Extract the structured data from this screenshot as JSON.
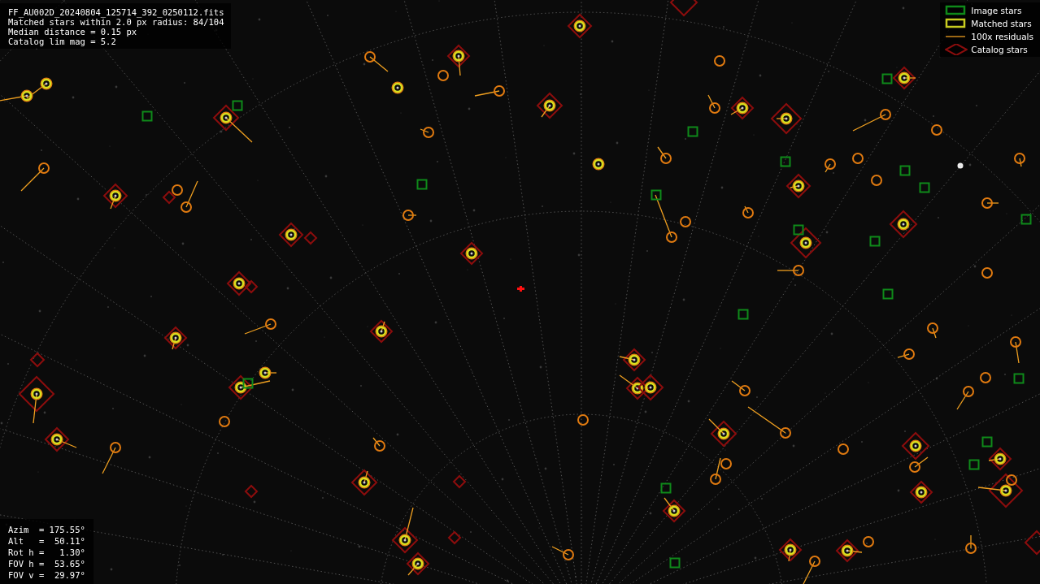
{
  "info_text": [
    "FF_AU002D_20240804_125714_392_0250112.fits",
    "Matched stars within 2.0 px radius: 84/104",
    "Median distance = 0.15 px",
    "Catalog lim mag = 5.2"
  ],
  "legend": [
    {
      "kind": "image",
      "label": "Image stars"
    },
    {
      "kind": "matched",
      "label": "Matched stars"
    },
    {
      "kind": "residual",
      "label": "100x residuals"
    },
    {
      "kind": "catalog",
      "label": "Catalog stars"
    }
  ],
  "pointing_info": [
    "Azim  = 175.55°",
    "Alt   =  50.11°",
    "Rot h =   1.30°",
    "FOV h =  53.65°",
    "FOV v =  29.97°"
  ]
}
